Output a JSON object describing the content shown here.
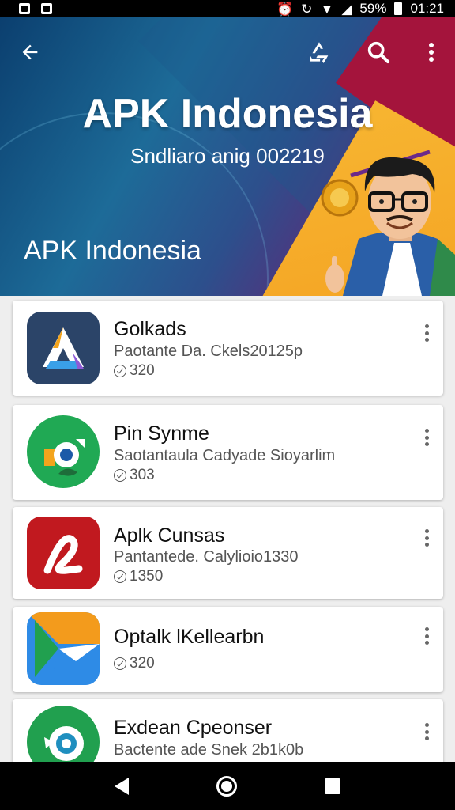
{
  "status_bar": {
    "battery": "59%",
    "time": "01:21"
  },
  "header": {
    "title": "APK Indonesia",
    "subtitle": "Sndliaro anig 002219",
    "label": "APK Indonesia"
  },
  "apps": [
    {
      "name": "Golkads",
      "desc": "Paotante Da. Ckels20125p",
      "count": "320"
    },
    {
      "name": "Pin Synme",
      "desc": "Saotantaula Cadyade Sioyarlim",
      "count": "303"
    },
    {
      "name": "Aplk Cunsas",
      "desc": "Pantantede. Calylioio1330",
      "count": "1350"
    },
    {
      "name": "Optalk lKellearbn",
      "desc": "",
      "count": "320"
    },
    {
      "name": "Exdean Cpeonser",
      "desc": "Bactente ade Snek 2b1k0b",
      "count": ""
    }
  ],
  "icons": {
    "back": "arrow-back-icon",
    "share": "share-icon",
    "search": "search-icon",
    "more": "more-vert-icon"
  },
  "colors": {
    "header_dark": "#0b3f6f",
    "accent_orange": "#f39b1c",
    "accent_red": "#a4143c"
  }
}
